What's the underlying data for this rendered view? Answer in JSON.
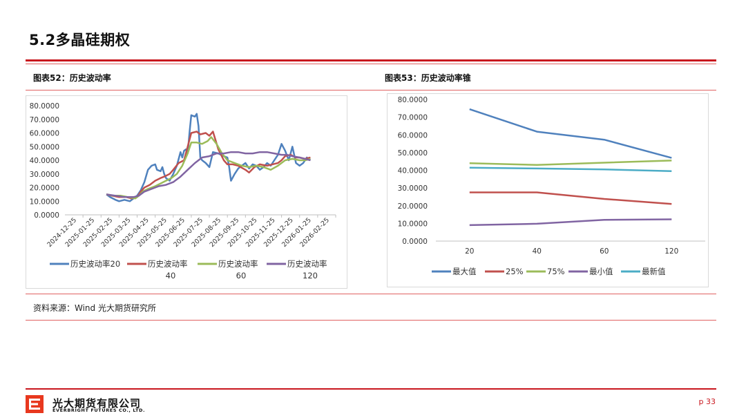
{
  "header": {
    "title": "5.2多晶硅期权"
  },
  "figures": {
    "left_title": "图表52：历史波动率",
    "right_title": "图表53：历史波动率锥"
  },
  "source_note": "资料来源：Wind 光大期货研究所",
  "footer": {
    "company_cn": "光大期货有限公司",
    "company_en": "EVERBRIGHT FUTURES CO., LTD.",
    "page": "p 33"
  },
  "colors": {
    "accent_red": "#c8161d",
    "blue": "#4f81bd",
    "red": "#c0504d",
    "green": "#9bbb59",
    "purple": "#8064a2",
    "cyan": "#4bacc6"
  },
  "chart_data": [
    {
      "type": "line",
      "title": "",
      "ylim": [
        0,
        80
      ],
      "yticks": [
        "0.0000",
        "10.0000",
        "20.0000",
        "30.0000",
        "40.0000",
        "50.0000",
        "60.0000",
        "70.0000",
        "80.0000"
      ],
      "categories": [
        "2024-12-25",
        "2025-01-25",
        "2025-02-25",
        "2025-03-25",
        "2025-04-25",
        "2025-05-25",
        "2025-06-25",
        "2025-07-25",
        "2025-08-25",
        "2025-09-25",
        "2025-10-25",
        "2025-11-25",
        "2025-12-25",
        "2026-01-25",
        "2026-02-25"
      ],
      "legend_position": "bottom",
      "series": [
        {
          "name": "历史波动率20",
          "legend_lines": [
            "历史波动率20"
          ],
          "color": "#4f81bd",
          "points": [
            [
              2.3,
              15
            ],
            [
              2.5,
              13
            ],
            [
              2.8,
              11
            ],
            [
              3.0,
              10
            ],
            [
              3.3,
              11
            ],
            [
              3.6,
              10
            ],
            [
              3.8,
              12
            ],
            [
              4.0,
              14
            ],
            [
              4.2,
              18
            ],
            [
              4.4,
              24
            ],
            [
              4.6,
              33
            ],
            [
              4.8,
              36
            ],
            [
              5.0,
              37
            ],
            [
              5.1,
              33
            ],
            [
              5.3,
              32
            ],
            [
              5.4,
              35
            ],
            [
              5.5,
              30
            ],
            [
              5.6,
              27
            ],
            [
              5.8,
              25
            ],
            [
              6.0,
              30
            ],
            [
              6.2,
              36
            ],
            [
              6.4,
              46
            ],
            [
              6.5,
              42
            ],
            [
              6.6,
              47
            ],
            [
              6.7,
              48
            ],
            [
              6.8,
              45
            ],
            [
              6.9,
              60
            ],
            [
              7.0,
              73
            ],
            [
              7.2,
              72
            ],
            [
              7.3,
              74
            ],
            [
              7.4,
              65
            ],
            [
              7.5,
              42
            ],
            [
              7.6,
              40
            ],
            [
              7.8,
              38
            ],
            [
              8.0,
              35
            ],
            [
              8.2,
              46
            ],
            [
              8.5,
              45
            ],
            [
              8.8,
              43
            ],
            [
              9.0,
              42
            ],
            [
              9.1,
              35
            ],
            [
              9.2,
              25
            ],
            [
              9.4,
              30
            ],
            [
              9.6,
              34
            ],
            [
              9.8,
              36
            ],
            [
              10.0,
              38
            ],
            [
              10.2,
              34
            ],
            [
              10.4,
              37
            ],
            [
              10.6,
              36
            ],
            [
              10.8,
              33
            ],
            [
              11.0,
              35
            ],
            [
              11.2,
              38
            ],
            [
              11.4,
              36
            ],
            [
              11.6,
              40
            ],
            [
              11.8,
              44
            ],
            [
              12.0,
              52
            ],
            [
              12.2,
              47
            ],
            [
              12.4,
              40
            ],
            [
              12.6,
              50
            ],
            [
              12.8,
              38
            ],
            [
              13.0,
              36
            ],
            [
              13.2,
              38
            ],
            [
              13.4,
              42
            ],
            [
              13.6,
              40
            ]
          ]
        },
        {
          "name": "历史波动率40",
          "legend_lines": [
            "历史波动率",
            "40"
          ],
          "color": "#c0504d",
          "points": [
            [
              2.3,
              15
            ],
            [
              2.6,
              14
            ],
            [
              3.0,
              13
            ],
            [
              3.4,
              13
            ],
            [
              3.7,
              12
            ],
            [
              4.0,
              13
            ],
            [
              4.2,
              17
            ],
            [
              4.4,
              20
            ],
            [
              4.7,
              22
            ],
            [
              5.0,
              25
            ],
            [
              5.3,
              27
            ],
            [
              5.5,
              28
            ],
            [
              5.8,
              30
            ],
            [
              6.0,
              33
            ],
            [
              6.3,
              38
            ],
            [
              6.6,
              40
            ],
            [
              6.8,
              50
            ],
            [
              7.0,
              60
            ],
            [
              7.3,
              61
            ],
            [
              7.5,
              59
            ],
            [
              7.8,
              60
            ],
            [
              8.0,
              58
            ],
            [
              8.2,
              61
            ],
            [
              8.5,
              48
            ],
            [
              8.8,
              40
            ],
            [
              9.0,
              37
            ],
            [
              9.3,
              37
            ],
            [
              9.6,
              36
            ],
            [
              10.0,
              33
            ],
            [
              10.2,
              31
            ],
            [
              10.5,
              35
            ],
            [
              10.8,
              37
            ],
            [
              11.2,
              36
            ],
            [
              11.5,
              37
            ],
            [
              11.8,
              38
            ],
            [
              12.0,
              40
            ],
            [
              12.2,
              43
            ],
            [
              12.5,
              44
            ],
            [
              12.8,
              42
            ],
            [
              13.0,
              42
            ],
            [
              13.3,
              41
            ],
            [
              13.6,
              42
            ]
          ]
        },
        {
          "name": "历史波动率60",
          "legend_lines": [
            "历史波动率",
            "60"
          ],
          "color": "#9bbb59",
          "points": [
            [
              2.3,
              15
            ],
            [
              2.7,
              14
            ],
            [
              3.1,
              14
            ],
            [
              3.5,
              13
            ],
            [
              3.9,
              12
            ],
            [
              4.1,
              14
            ],
            [
              4.3,
              17
            ],
            [
              4.6,
              19
            ],
            [
              5.0,
              21
            ],
            [
              5.3,
              23
            ],
            [
              5.6,
              25
            ],
            [
              5.9,
              27
            ],
            [
              6.2,
              30
            ],
            [
              6.5,
              36
            ],
            [
              6.8,
              45
            ],
            [
              7.0,
              53
            ],
            [
              7.3,
              53
            ],
            [
              7.6,
              52
            ],
            [
              7.9,
              54
            ],
            [
              8.1,
              57
            ],
            [
              8.4,
              52
            ],
            [
              8.7,
              45
            ],
            [
              9.0,
              40
            ],
            [
              9.4,
              38
            ],
            [
              9.8,
              36
            ],
            [
              10.2,
              35
            ],
            [
              10.6,
              36
            ],
            [
              11.0,
              35
            ],
            [
              11.4,
              33
            ],
            [
              11.8,
              36
            ],
            [
              12.2,
              40
            ],
            [
              12.6,
              41
            ],
            [
              13.0,
              40
            ],
            [
              13.3,
              40
            ],
            [
              13.6,
              41
            ]
          ]
        },
        {
          "name": "历史波动率120",
          "legend_lines": [
            "历史波动率",
            "120"
          ],
          "color": "#8064a2",
          "points": [
            [
              2.3,
              15
            ],
            [
              2.8,
              14
            ],
            [
              3.3,
              13
            ],
            [
              3.8,
              13
            ],
            [
              4.1,
              14
            ],
            [
              4.4,
              17
            ],
            [
              4.8,
              19
            ],
            [
              5.2,
              21
            ],
            [
              5.6,
              22
            ],
            [
              6.0,
              24
            ],
            [
              6.4,
              28
            ],
            [
              6.8,
              33
            ],
            [
              7.2,
              38
            ],
            [
              7.6,
              42
            ],
            [
              8.0,
              43
            ],
            [
              8.4,
              45
            ],
            [
              8.8,
              45
            ],
            [
              9.2,
              46
            ],
            [
              9.6,
              46
            ],
            [
              10.0,
              45
            ],
            [
              10.4,
              45
            ],
            [
              10.8,
              46
            ],
            [
              11.2,
              46
            ],
            [
              11.6,
              45
            ],
            [
              12.0,
              44
            ],
            [
              12.3,
              44
            ],
            [
              12.6,
              43
            ],
            [
              13.0,
              42
            ],
            [
              13.3,
              41
            ],
            [
              13.6,
              40
            ]
          ]
        }
      ]
    },
    {
      "type": "line",
      "title": "",
      "ylim": [
        0,
        80
      ],
      "yticks": [
        "0.0000",
        "10.0000",
        "20.0000",
        "30.0000",
        "40.0000",
        "50.0000",
        "60.0000",
        "70.0000",
        "80.0000"
      ],
      "categories": [
        "20",
        "40",
        "60",
        "120"
      ],
      "legend_position": "bottom",
      "series": [
        {
          "name": "最大值",
          "color": "#4f81bd",
          "values": [
            74.5,
            61.8,
            57.3,
            47.0
          ]
        },
        {
          "name": "25%",
          "color": "#c0504d",
          "values": [
            27.5,
            27.5,
            23.8,
            21.0
          ]
        },
        {
          "name": "75%",
          "color": "#9bbb59",
          "values": [
            44.0,
            43.0,
            44.3,
            45.5
          ]
        },
        {
          "name": "最小值",
          "color": "#8064a2",
          "values": [
            9.0,
            9.8,
            12.0,
            12.3
          ]
        },
        {
          "name": "最新值",
          "color": "#4bacc6",
          "values": [
            41.5,
            41.0,
            40.5,
            39.5
          ]
        }
      ]
    }
  ]
}
